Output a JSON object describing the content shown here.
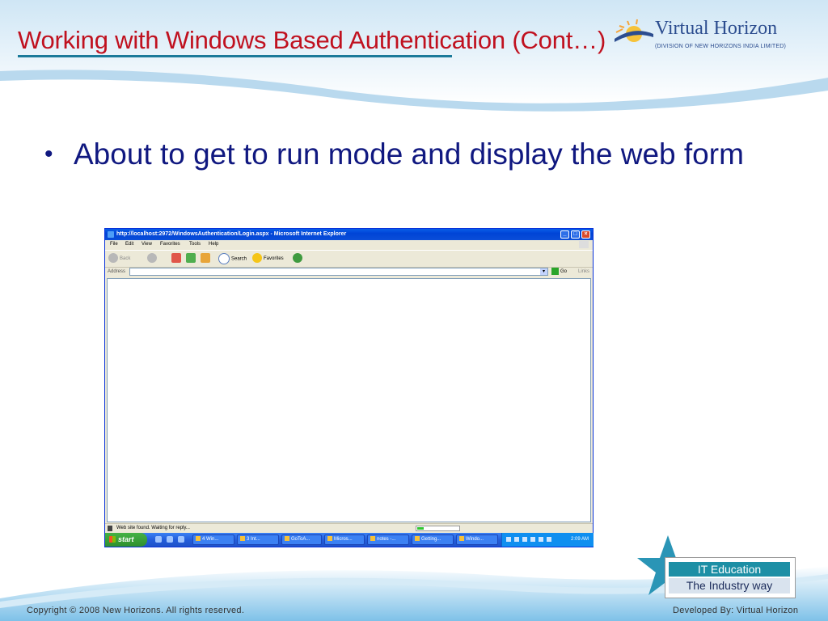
{
  "slide": {
    "title": "Working with Windows Based Authentication (Cont…)",
    "bullet": "About to get to run mode and display the web form"
  },
  "logo": {
    "name": "Virtual Horizon",
    "subtitle": "(DIVISION OF NEW HORIZONS INDIA LIMITED)"
  },
  "ie_window": {
    "title": "http://localhost:2972/WindowsAuthentication/Login.aspx - Microsoft Internet Explorer",
    "menu": [
      "File",
      "Edit",
      "View",
      "Favorites",
      "Tools",
      "Help"
    ],
    "toolbar": {
      "back": "Back",
      "search": "Search",
      "favorites": "Favorites"
    },
    "address_label": "Address",
    "address_value": "",
    "go_label": "Go",
    "links_label": "Links",
    "status_text": "Web site found. Waiting for reply...",
    "progress": 0.15
  },
  "taskbar": {
    "start_label": "start",
    "tasks": [
      "4 Win...",
      "3 Int...",
      "GoToA...",
      "Micros...",
      "notes -...",
      "Getting...",
      "Windo..."
    ],
    "clock": "2:09 AM"
  },
  "badge": {
    "line1": "IT Education",
    "line2": "The Industry way"
  },
  "footer": {
    "copyright": "Copyright © 2008 New Horizons. All rights reserved.",
    "developer": "Developed By: Virtual Horizon"
  },
  "colors": {
    "title": "#c0111f",
    "bullet": "#101880",
    "accent_blue": "#1d8fa5"
  }
}
